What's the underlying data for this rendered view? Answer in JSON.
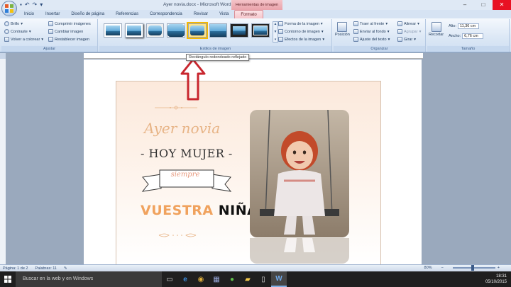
{
  "window": {
    "title": "Ayer novia.docx - Microsoft Word",
    "context_tab_header": "Herramientas de imagen"
  },
  "tabs": [
    "Inicio",
    "Insertar",
    "Diseño de página",
    "Referencias",
    "Correspondencia",
    "Revisar",
    "Vista",
    "Formato"
  ],
  "ribbon": {
    "adjust": {
      "brillo": "Brillo",
      "contraste": "Contraste",
      "volver_colorear": "Volver a colorear",
      "comprimir": "Comprimir imágenes",
      "cambiar": "Cambiar imagen",
      "restablecer": "Restablecer imagen",
      "label": "Ajustar"
    },
    "styles": {
      "label": "Estilos de imagen",
      "forma": "Forma de la imagen",
      "contorno": "Contorno de imagen",
      "efectos": "Efectos de la imagen",
      "selected_index": 4
    },
    "arrange": {
      "posicion": "Posición",
      "traer": "Traer al frente",
      "enviar": "Enviar al fondo",
      "ajuste": "Ajuste del texto",
      "alinear": "Alinear",
      "agrupar": "Agrupar",
      "girar": "Girar",
      "label": "Organizar"
    },
    "size": {
      "recortar": "Recortar",
      "alto_label": "Alto:",
      "alto_value": "11,36 cm",
      "ancho_label": "Ancho:",
      "ancho_value": "6,76 cm",
      "label": "Tamaño"
    }
  },
  "tooltip": "Rectángulo redondeado reflejado",
  "document": {
    "line1": "Ayer novia",
    "line2": "- HOY MUJER -",
    "banner": "siempre",
    "line3a": "VUESTRA ",
    "line3b": "NIÑA"
  },
  "statusbar": {
    "page": "Página: 1 de 2",
    "words": "Palabras: 11",
    "zoom": "80%"
  },
  "taskbar": {
    "search_placeholder": "Buscar en la web y en Windows",
    "time": "18:31",
    "date": "05/10/2015"
  },
  "colors": {
    "accent_context": "#eaa3ab",
    "arrow": "#c8262e",
    "title_orange": "#f0a25e"
  }
}
